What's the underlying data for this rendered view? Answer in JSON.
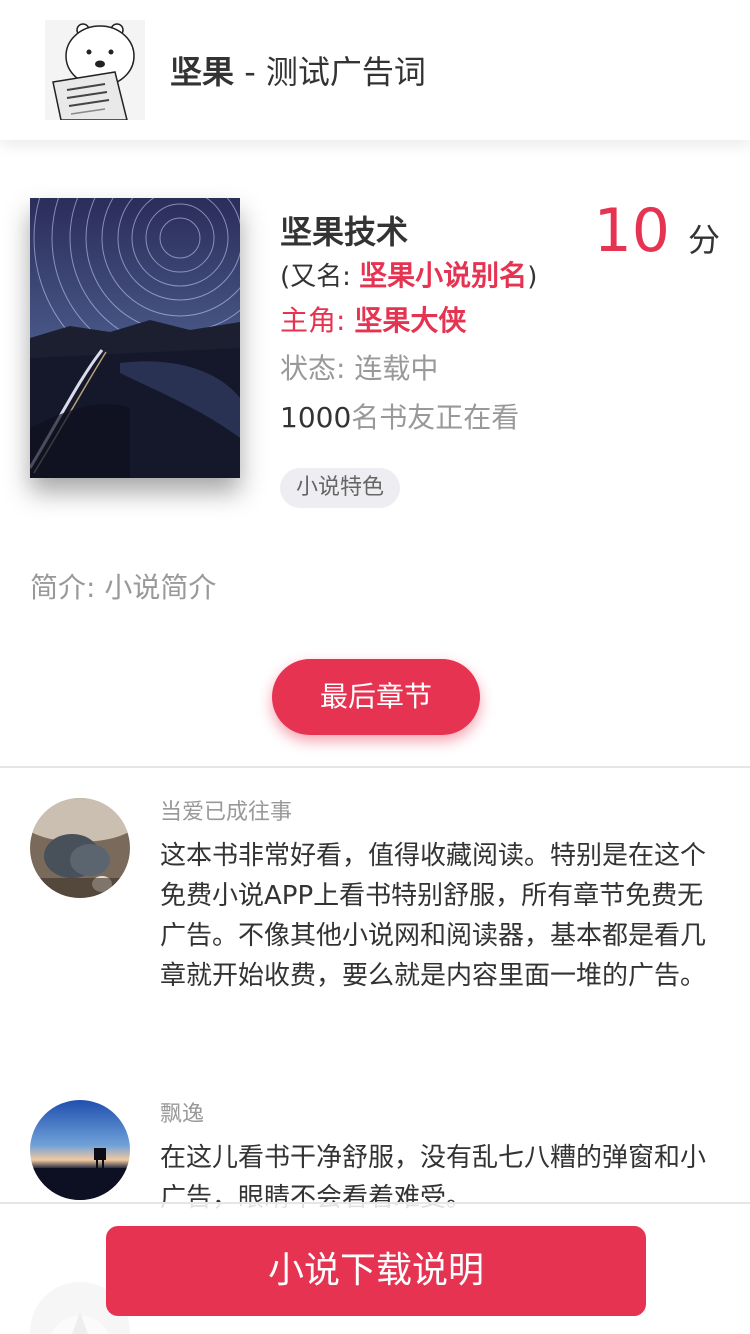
{
  "header": {
    "app_name": "坚果",
    "separator": " - ",
    "slogan": "测试广告词"
  },
  "book": {
    "title": "坚果技术",
    "score": "10",
    "score_unit": "分",
    "alias_prefix": "(又名: ",
    "alias_name": "坚果小说别名",
    "alias_suffix": ")",
    "protagonist_label": "主角: ",
    "protagonist_name": "坚果大侠",
    "status": "状态: 连载中",
    "readers_count": "1000",
    "readers_suffix": "名书友正在看",
    "tag": "小说特色",
    "intro": "简介: 小说简介",
    "last_chapter_label": "最后章节"
  },
  "comments": [
    {
      "name": "当爱已成往事",
      "text": "这本书非常好看，值得收藏阅读。特别是在这个免费小说APP上看书特别舒服，所有章节免费无广告。不像其他小说网和阅读器，基本都是看几章就开始收费，要么就是内容里面一堆的广告。"
    },
    {
      "name": "飘逸",
      "text": "在这儿看书干净舒服，没有乱七八糟的弹窗和小广告，眼睛不会看着难受。"
    }
  ],
  "bottom": {
    "download_label": "小说下载说明"
  },
  "colors": {
    "accent": "#e63351",
    "text": "#333333",
    "muted": "#999999"
  }
}
